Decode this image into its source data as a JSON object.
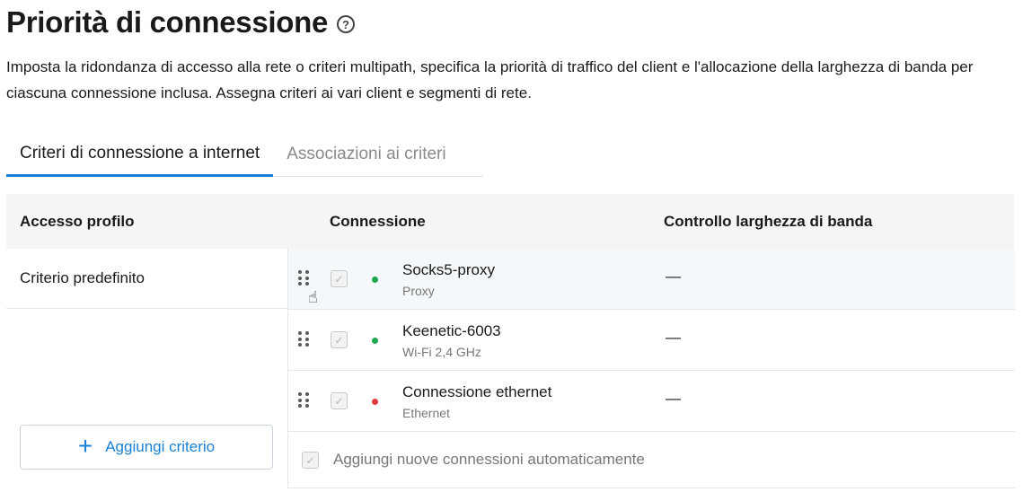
{
  "header": {
    "title": "Priorità di connessione",
    "help_icon": "question-circle-icon",
    "help_glyph": "?",
    "description": "Imposta la ridondanza di accesso alla rete o criteri multipath, specifica la priorità di traffico del client e l'allocazione della larghezza di banda per ciascuna connessione inclusa. Assegna criteri ai vari client e segmenti di rete."
  },
  "tabs": [
    {
      "label": "Criteri di connessione a internet",
      "active": true
    },
    {
      "label": "Associazioni ai criteri",
      "active": false
    }
  ],
  "table": {
    "headers": {
      "profile": "Accesso profilo",
      "connection": "Connessione",
      "bandwidth": "Controllo larghezza di banda"
    },
    "profiles": [
      {
        "name": "Criterio predefinito"
      }
    ],
    "connections": [
      {
        "name": "Socks5-proxy",
        "type": "Proxy",
        "status_color": "#1fa84f",
        "bandwidth": "—",
        "checked": true
      },
      {
        "name": "Keenetic-6003",
        "type": "Wi-Fi 2,4 GHz",
        "status_color": "#1fa84f",
        "bandwidth": "—",
        "checked": true
      },
      {
        "name": "Connessione ethernet",
        "type": "Ethernet",
        "status_color": "#e0393e",
        "bandwidth": "—",
        "checked": true
      }
    ],
    "auto_add_label": "Aggiungi nuove connessioni automaticamente",
    "add_button_label": "Aggiungi criterio",
    "add_button_glyph": "+"
  },
  "colors": {
    "accent": "#1a7fd6",
    "status_up": "#1fa84f",
    "status_down": "#e0393e"
  }
}
